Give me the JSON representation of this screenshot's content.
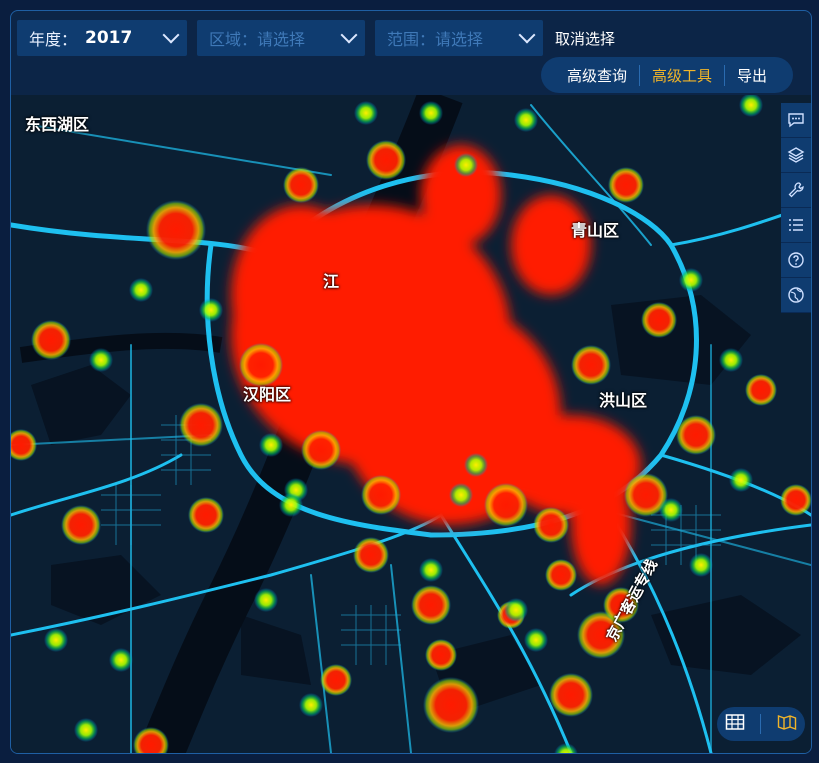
{
  "filters": {
    "year_label": "年度：",
    "year_value": "2017",
    "region_placeholder": "区域：请选择",
    "scope_placeholder": "范围：请选择",
    "clear_label": "取消选择"
  },
  "toolbar": {
    "advanced_query": "高级查询",
    "advanced_tools": "高级工具",
    "export": "导出"
  },
  "map": {
    "places": [
      {
        "name": "东西湖区"
      },
      {
        "name": "青山区"
      },
      {
        "name": "汉阳区"
      },
      {
        "name": "洪山区"
      },
      {
        "name": "江"
      },
      {
        "name": "京广客运专线"
      }
    ]
  },
  "side_tools": [
    "chat-icon",
    "layers-icon",
    "wrench-icon",
    "list-icon",
    "help-icon",
    "globe-icon"
  ],
  "bottom_tools": [
    "table-icon",
    "map-icon"
  ],
  "colors": {
    "accent": "#f0b429",
    "panel": "#0f3c70",
    "road": "#1ec0f0"
  }
}
